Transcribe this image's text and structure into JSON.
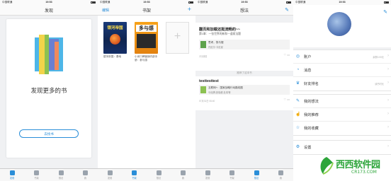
{
  "status": {
    "carrier": "中国联通",
    "time": "19:53"
  },
  "tabs": [
    {
      "label": "发现",
      "icon": "compass-icon"
    },
    {
      "label": "书架",
      "icon": "bookshelf-icon"
    },
    {
      "label": "想法",
      "icon": "chat-bubble-icon"
    },
    {
      "label": "我",
      "icon": "person-icon"
    }
  ],
  "screen1": {
    "title": "发现",
    "headline": "发现更多的书",
    "button": "去找书"
  },
  "screen2": {
    "title": "书架",
    "edit": "编辑",
    "add": "+",
    "books": [
      {
        "cover_text": "银河帝国",
        "title": "银河帝国：基地"
      },
      {
        "cover_text": "多与感",
        "title": "小米口碑营销内部手册：参与感"
      }
    ]
  },
  "screen3": {
    "title": "想法",
    "post1": {
      "title": "翻页和加载还挺流畅的~~",
      "subtitle": "第1章：一张世界的新和一道蒸法题",
      "quote_title": "思考，快与慢",
      "quote_author": "丹尼尔·卡尼曼",
      "meta": "2分钟前"
    },
    "recommend_label": "推荐了这本书",
    "post2": {
      "title": "testtesttest",
      "quote_title": "互联网+：国家战略行动路线图",
      "quote_author": "马化腾,张晓峰,杜军等",
      "meta": "07月31日 06:40"
    }
  },
  "screen4": {
    "groups": [
      [
        {
          "label": "账户",
          "value": "余额0.00元",
          "icon": "coin-icon"
        },
        {
          "label": "消息",
          "value": "",
          "icon": "bell-icon"
        },
        {
          "label": "好友排名",
          "value": "读书时长",
          "icon": "trophy-icon"
        }
      ],
      [
        {
          "label": "我的想法",
          "value": "",
          "icon": "pencil-icon"
        },
        {
          "label": "我的推荐",
          "value": "",
          "icon": "thumb-icon"
        },
        {
          "label": "我的收藏",
          "value": "",
          "icon": "star-icon"
        }
      ],
      [
        {
          "label": "设置",
          "value": "",
          "icon": "gear-icon"
        }
      ]
    ]
  },
  "watermark": {
    "text": "西西软件园",
    "url": "CR173.COM"
  },
  "colors": {
    "accent": "#2a8ed8",
    "watermark": "#2da53a"
  }
}
